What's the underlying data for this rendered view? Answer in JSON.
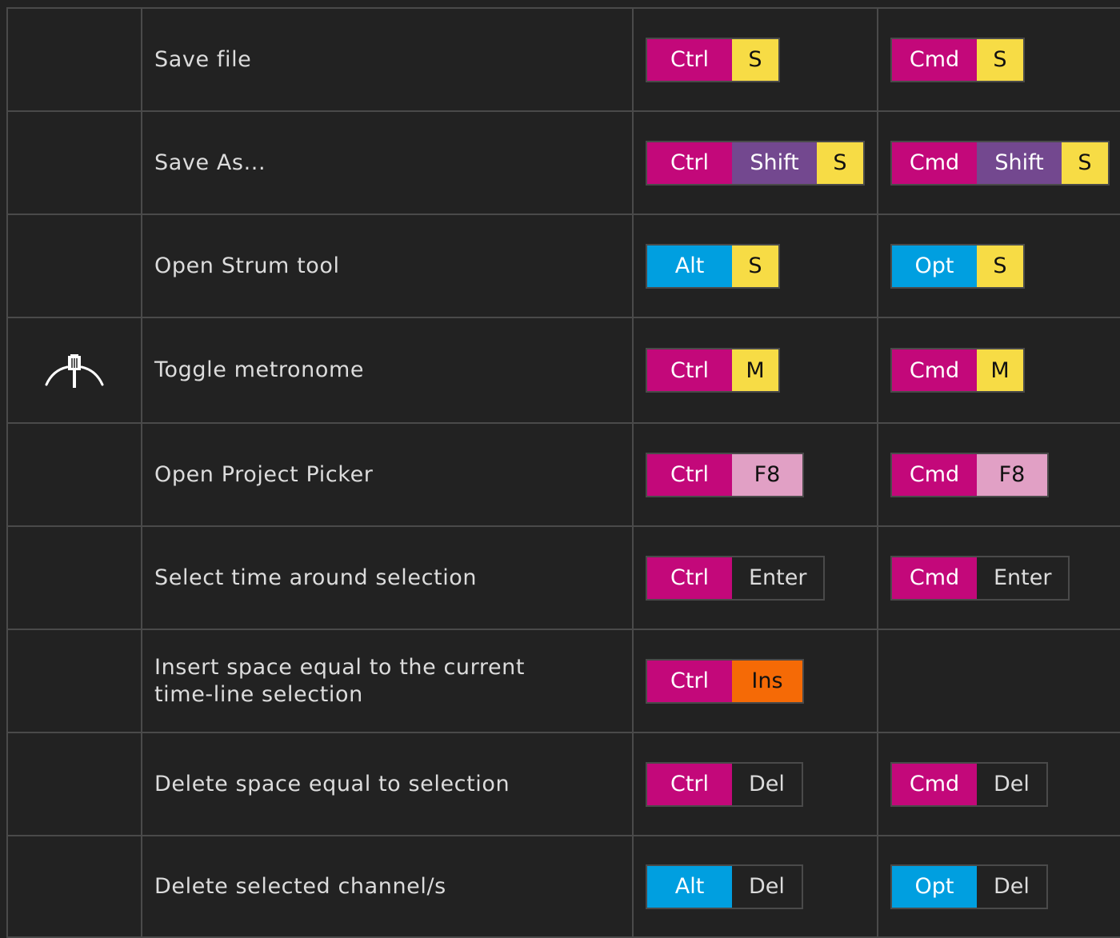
{
  "colors": {
    "background": "#222222",
    "border": "#4a4a4a",
    "text": "#dcdcdc",
    "ctrl_cmd": "#c3087a",
    "shift": "#73488f",
    "alt_opt": "#009fe0",
    "letter_yellow": "#f7dc45",
    "fkey_pink": "#e1a0c5",
    "ins_orange": "#f56a06",
    "plain_key": "#222222"
  },
  "rows": [
    {
      "desc": "Save file",
      "icon": "",
      "win": [
        {
          "label": "Ctrl",
          "kind": "ctrl"
        },
        {
          "label": "S",
          "kind": "letter"
        }
      ],
      "mac": [
        {
          "label": "Cmd",
          "kind": "ctrl"
        },
        {
          "label": "S",
          "kind": "letter"
        }
      ]
    },
    {
      "desc": "Save As...",
      "icon": "",
      "win": [
        {
          "label": "Ctrl",
          "kind": "ctrl"
        },
        {
          "label": "Shift",
          "kind": "shift"
        },
        {
          "label": "S",
          "kind": "letter"
        }
      ],
      "mac": [
        {
          "label": "Cmd",
          "kind": "ctrl"
        },
        {
          "label": "Shift",
          "kind": "shift"
        },
        {
          "label": "S",
          "kind": "letter"
        }
      ]
    },
    {
      "desc": "Open Strum tool",
      "icon": "",
      "win": [
        {
          "label": "Alt",
          "kind": "alt"
        },
        {
          "label": "S",
          "kind": "letter"
        }
      ],
      "mac": [
        {
          "label": "Opt",
          "kind": "alt"
        },
        {
          "label": "S",
          "kind": "letter"
        }
      ]
    },
    {
      "desc": "Toggle metronome",
      "icon": "metronome-icon",
      "win": [
        {
          "label": "Ctrl",
          "kind": "ctrl"
        },
        {
          "label": "M",
          "kind": "letter"
        }
      ],
      "mac": [
        {
          "label": "Cmd",
          "kind": "ctrl"
        },
        {
          "label": "M",
          "kind": "letter"
        }
      ]
    },
    {
      "desc": "Open Project Picker",
      "icon": "",
      "win": [
        {
          "label": "Ctrl",
          "kind": "ctrl"
        },
        {
          "label": "F8",
          "kind": "fkey"
        }
      ],
      "mac": [
        {
          "label": "Cmd",
          "kind": "ctrl"
        },
        {
          "label": "F8",
          "kind": "fkey"
        }
      ]
    },
    {
      "desc": "Select time around selection",
      "icon": "",
      "win": [
        {
          "label": "Ctrl",
          "kind": "ctrl"
        },
        {
          "label": "Enter",
          "kind": "plain"
        }
      ],
      "mac": [
        {
          "label": "Cmd",
          "kind": "ctrl"
        },
        {
          "label": "Enter",
          "kind": "plain"
        }
      ]
    },
    {
      "desc": "Insert space equal to the current\ntime-line selection",
      "icon": "",
      "win": [
        {
          "label": "Ctrl",
          "kind": "ctrl"
        },
        {
          "label": "Ins",
          "kind": "ins"
        }
      ],
      "mac": []
    },
    {
      "desc": "Delete space equal to selection",
      "icon": "",
      "win": [
        {
          "label": "Ctrl",
          "kind": "ctrl"
        },
        {
          "label": "Del",
          "kind": "plain"
        }
      ],
      "mac": [
        {
          "label": "Cmd",
          "kind": "ctrl"
        },
        {
          "label": "Del",
          "kind": "plain"
        }
      ]
    },
    {
      "desc": "Delete selected channel/s",
      "icon": "",
      "win": [
        {
          "label": "Alt",
          "kind": "alt"
        },
        {
          "label": "Del",
          "kind": "plain"
        }
      ],
      "mac": [
        {
          "label": "Opt",
          "kind": "alt"
        },
        {
          "label": "Del",
          "kind": "plain"
        }
      ]
    }
  ]
}
